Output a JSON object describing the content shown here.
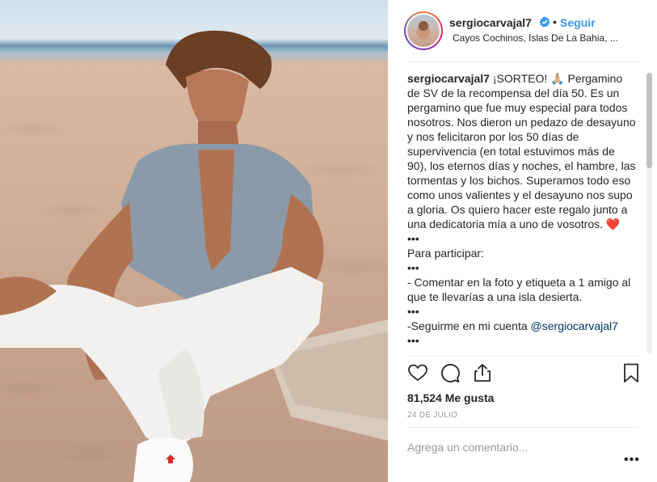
{
  "post": {
    "username": "sergiocarvajal7",
    "follow_label": "Seguir",
    "separator": "•",
    "location": "Cayos Cochinos, Islas De La Bahia, ...",
    "caption_user": "sergiocarvajal7",
    "caption_text": " ¡SORTEO! 🙏🏼 Pergamino de SV de la recompensa del día 50. Es un pergamino que fue muy especial para todos nosotros. Nos dieron un pedazo de desayuno y nos felicitaron por los 50 días de supervivencia (en total estuvimos más de 90), los eternos días y noches, el hambre, las tormentas y los bichos. Superamos todo eso como unos valientes y el desayuno nos supo a gloria. Os quiero hacer este regalo junto a una dedicatoria mía a uno de vosotros. ❤️\n•••\nPara participar:\n•••\n- Comentar en la foto y etiqueta a 1 amigo al que te llevarías a una isla desierta.\n•••\n-Seguirme en mi cuenta ",
    "caption_mention": "@sergiocarvajal7",
    "caption_tail": "\n•••",
    "likes": "81,524 Me gusta",
    "date": "24 DE JULIO",
    "comment_placeholder": "Agrega un comentario...",
    "more_label": "•••",
    "icons": [
      "heart-icon",
      "comment-icon",
      "share-icon",
      "bookmark-icon",
      "verified-icon"
    ],
    "colors": {
      "link": "#3897f0",
      "verified": "#3897f0",
      "muted": "#999999"
    }
  }
}
